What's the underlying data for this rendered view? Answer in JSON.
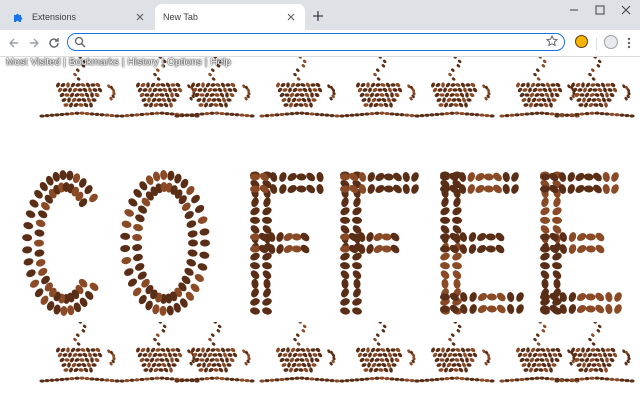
{
  "tabs": [
    {
      "title": "Extensions",
      "icon": "puzzle-icon",
      "active": false
    },
    {
      "title": "New Tab",
      "icon": "",
      "active": true
    }
  ],
  "omnibox": {
    "value": "",
    "placeholder": ""
  },
  "nav_links": [
    "Most Visited",
    "Bookmarks",
    "History",
    "Options",
    "Help"
  ],
  "nav_separator": "|",
  "wallpaper": {
    "word": "COFFEE",
    "bean_color": "#5a2e16",
    "bean_highlight": "#8a4a26"
  },
  "colors": {
    "tabstrip": "#dee1e6",
    "accent": "#1a73e8"
  }
}
